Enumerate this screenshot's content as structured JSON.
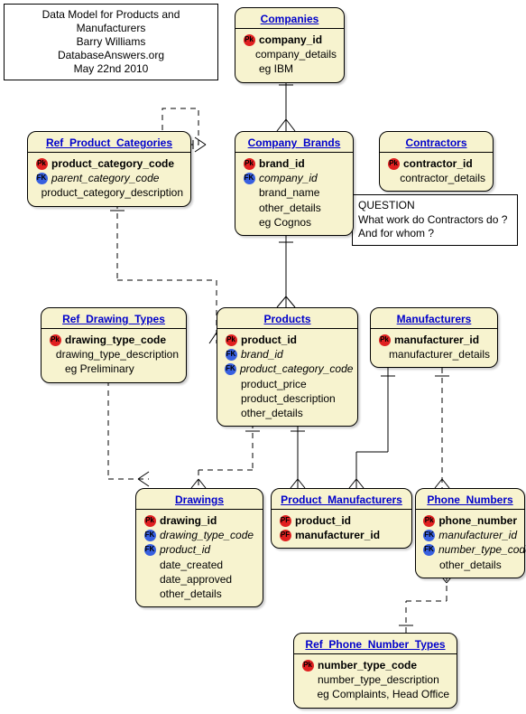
{
  "info": {
    "line1": "Data Model for Products and Manufacturers",
    "line2": "Barry Williams",
    "line3": "DatabaseAnswers.org",
    "line4": "May 22nd 2010"
  },
  "question": {
    "line1": "QUESTION",
    "line2": "What work do Contractors do ?",
    "line3": "And for whom ?"
  },
  "key_glyphs": {
    "pk": "Pk",
    "fk": "FK",
    "pf": "PF"
  },
  "entities": {
    "companies": {
      "title": "Companies",
      "attrs": [
        {
          "key": "pk",
          "label": "company_id",
          "style": "bold"
        },
        {
          "key": "",
          "label": "company_details"
        },
        {
          "key": "",
          "label": "eg IBM"
        }
      ]
    },
    "contractors": {
      "title": "Contractors",
      "attrs": [
        {
          "key": "pk",
          "label": "contractor_id",
          "style": "bold"
        },
        {
          "key": "",
          "label": "contractor_details"
        }
      ]
    },
    "ref_product_categories": {
      "title": "Ref_Product_Categories",
      "attrs": [
        {
          "key": "pk",
          "label": "product_category_code",
          "style": "bold"
        },
        {
          "key": "fk",
          "label": "parent_category_code",
          "style": "italic"
        },
        {
          "key": "",
          "label": "product_category_description"
        }
      ]
    },
    "company_brands": {
      "title": "Company_Brands",
      "attrs": [
        {
          "key": "pk",
          "label": "brand_id",
          "style": "bold"
        },
        {
          "key": "fk",
          "label": "company_id",
          "style": "italic"
        },
        {
          "key": "",
          "label": "brand_name"
        },
        {
          "key": "",
          "label": "other_details"
        },
        {
          "key": "",
          "label": "eg Cognos"
        }
      ]
    },
    "ref_drawing_types": {
      "title": "Ref_Drawing_Types",
      "attrs": [
        {
          "key": "pk",
          "label": "drawing_type_code",
          "style": "bold"
        },
        {
          "key": "",
          "label": "drawing_type_description"
        },
        {
          "key": "",
          "label": "eg Preliminary"
        }
      ]
    },
    "products": {
      "title": "Products",
      "attrs": [
        {
          "key": "pk",
          "label": "product_id",
          "style": "bold"
        },
        {
          "key": "fk",
          "label": "brand_id",
          "style": "italic"
        },
        {
          "key": "fk",
          "label": "product_category_code",
          "style": "italic"
        },
        {
          "key": "",
          "label": "product_price"
        },
        {
          "key": "",
          "label": "product_description"
        },
        {
          "key": "",
          "label": "other_details"
        }
      ]
    },
    "manufacturers": {
      "title": "Manufacturers",
      "attrs": [
        {
          "key": "pk",
          "label": "manufacturer_id",
          "style": "bold"
        },
        {
          "key": "",
          "label": "manufacturer_details"
        }
      ]
    },
    "drawings": {
      "title": "Drawings",
      "attrs": [
        {
          "key": "pk",
          "label": "drawing_id",
          "style": "bold"
        },
        {
          "key": "fk",
          "label": "drawing_type_code",
          "style": "italic"
        },
        {
          "key": "fk",
          "label": "product_id",
          "style": "italic"
        },
        {
          "key": "",
          "label": "date_created"
        },
        {
          "key": "",
          "label": "date_approved"
        },
        {
          "key": "",
          "label": "other_details"
        }
      ]
    },
    "product_manufacturers": {
      "title": "Product_Manufacturers",
      "attrs": [
        {
          "key": "pf",
          "label": "product_id",
          "style": "bold"
        },
        {
          "key": "pf",
          "label": "manufacturer_id",
          "style": "bold"
        }
      ]
    },
    "phone_numbers": {
      "title": "Phone_Numbers",
      "attrs": [
        {
          "key": "pk",
          "label": "phone_number",
          "style": "bold"
        },
        {
          "key": "fk",
          "label": "manufacturer_id",
          "style": "italic"
        },
        {
          "key": "fk",
          "label": "number_type_code",
          "style": "italic"
        },
        {
          "key": "",
          "label": "other_details"
        }
      ]
    },
    "ref_phone_number_types": {
      "title": "Ref_Phone_Number_Types",
      "attrs": [
        {
          "key": "pk",
          "label": "number_type_code",
          "style": "bold"
        },
        {
          "key": "",
          "label": "number_type_description"
        },
        {
          "key": "",
          "label": "eg Complaints, Head Office"
        }
      ]
    }
  },
  "relationships": [
    {
      "from": "companies",
      "to": "company_brands",
      "type": "one-to-many",
      "identifying": true
    },
    {
      "from": "company_brands",
      "to": "products",
      "type": "one-to-many",
      "identifying": true
    },
    {
      "from": "ref_product_categories",
      "to": "products",
      "type": "one-to-many",
      "identifying": false
    },
    {
      "from": "ref_product_categories",
      "to": "ref_product_categories",
      "type": "self-one-to-many",
      "identifying": false
    },
    {
      "from": "ref_drawing_types",
      "to": "drawings",
      "type": "one-to-many",
      "identifying": false
    },
    {
      "from": "products",
      "to": "drawings",
      "type": "one-to-many",
      "identifying": false
    },
    {
      "from": "products",
      "to": "product_manufacturers",
      "type": "one-to-many",
      "identifying": true
    },
    {
      "from": "manufacturers",
      "to": "product_manufacturers",
      "type": "one-to-many",
      "identifying": true
    },
    {
      "from": "manufacturers",
      "to": "phone_numbers",
      "type": "one-to-many",
      "identifying": false
    },
    {
      "from": "ref_phone_number_types",
      "to": "phone_numbers",
      "type": "one-to-many",
      "identifying": false
    }
  ]
}
